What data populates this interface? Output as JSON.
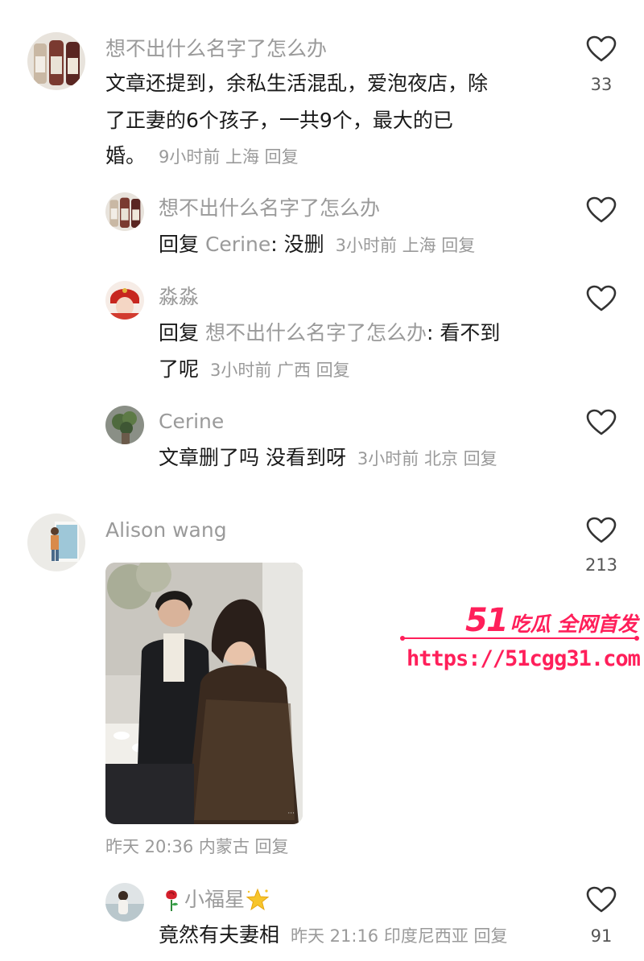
{
  "comments": [
    {
      "user": "想不出什么名字了怎么办",
      "text_lines": [
        "文章还提到，余私生活混乱，爱泡夜店，除",
        "了正妻的6个孩子，一共9个，最大的已",
        "婚。"
      ],
      "meta": "9小时前 上海 回复",
      "likes": "33",
      "avatar_icon": "wine-bottles-avatar",
      "replies": [
        {
          "user": "想不出什么名字了怎么办",
          "reply_prefix": "回复",
          "reply_to": "Cerine",
          "text": ": 没删",
          "meta": "3小时前 上海 回复",
          "avatar_icon": "wine-bottles-avatar"
        },
        {
          "user": "淼淼",
          "reply_prefix": "回复",
          "reply_to": "想不出什么名字了怎么办",
          "text": ": 看不到",
          "text_line2": "了呢",
          "meta": "3小时前 广西 回复",
          "avatar_icon": "red-costume-avatar"
        },
        {
          "user": "Cerine",
          "text": "文章删了吗 没看到呀",
          "meta": "3小时前 北京 回复",
          "avatar_icon": "plant-avatar"
        }
      ]
    },
    {
      "user": "Alison wang",
      "likes": "213",
      "meta": "昨天 20:36 内蒙古 回复",
      "avatar_icon": "person-wall-avatar",
      "image_icon": "couple-photo",
      "replies": [
        {
          "user": "小福星",
          "user_prefix_icon": "rose-icon",
          "user_suffix_icon": "sparkle-star-icon",
          "text": "竟然有夫妻相",
          "meta": "昨天 21:16 印度尼西亚 回复",
          "likes": "91",
          "avatar_icon": "seaside-person-avatar"
        }
      ]
    }
  ],
  "watermark": {
    "brand_num": "51",
    "brand_text": "吃瓜 全网首发",
    "url": "https://51cgg31.com"
  },
  "colors": {
    "username": "#9a9a9a",
    "body_text": "#1a1a1a",
    "meta": "#9a9a9a",
    "watermark": "#ff1f5a"
  }
}
